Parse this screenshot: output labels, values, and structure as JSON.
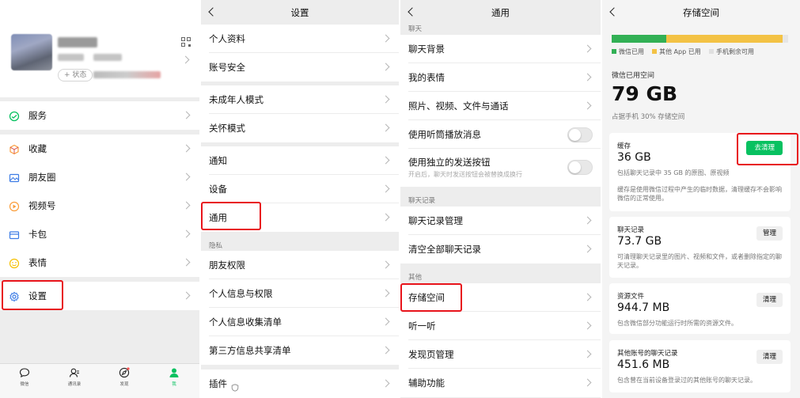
{
  "panel1": {
    "status_label": "+ 状态",
    "items": [
      {
        "label": "服务",
        "icon": "service-icon",
        "color": "#07c160"
      },
      {
        "label": "收藏",
        "icon": "favorites-icon",
        "color": "#fa9d3b"
      },
      {
        "label": "朋友圈",
        "icon": "moments-icon",
        "color": "#3d7ce5"
      },
      {
        "label": "视频号",
        "icon": "channels-icon",
        "color": "#fa9d3b"
      },
      {
        "label": "卡包",
        "icon": "card-icon",
        "color": "#3d7ce5"
      },
      {
        "label": "表情",
        "icon": "sticker-icon",
        "color": "#f5c000"
      },
      {
        "label": "设置",
        "icon": "settings-icon",
        "color": "#3d7ce5"
      }
    ],
    "tabs": [
      {
        "label": "微信",
        "icon": "chat-tab-icon"
      },
      {
        "label": "通讯录",
        "icon": "contacts-tab-icon"
      },
      {
        "label": "发现",
        "icon": "discover-tab-icon"
      },
      {
        "label": "我",
        "icon": "me-tab-icon",
        "active": true
      }
    ]
  },
  "panel2": {
    "title": "设置",
    "items": [
      "个人资料",
      "账号安全",
      "未成年人模式",
      "关怀模式",
      "通知",
      "设备",
      "通用"
    ],
    "section_privacy": "隐私",
    "privacy_items": [
      "朋友权限",
      "个人信息与权限",
      "个人信息收集清单",
      "第三方信息共享清单"
    ],
    "plugin": "插件"
  },
  "panel3": {
    "title": "通用",
    "section_chat": "聊天",
    "chat_items": [
      "聊天背景",
      "我的表情",
      "照片、视频、文件与通话"
    ],
    "toggle1": "使用听筒播放消息",
    "toggle2": "使用独立的发送按钮",
    "toggle2_desc": "开启后，聊天时发送按钮会被替换成换行",
    "section_history": "聊天记录",
    "history_items": [
      "聊天记录管理",
      "清空全部聊天记录"
    ],
    "section_other": "其他",
    "other_items": [
      "存储空间",
      "听一听",
      "发现页管理",
      "辅助功能"
    ]
  },
  "panel4": {
    "title": "存储空间",
    "usage": [
      {
        "label": "微信已用",
        "color": "#32b055",
        "fraction": 0.31
      },
      {
        "label": "其他 App 已用",
        "color": "#f3c245",
        "fraction": 0.66
      },
      {
        "label": "手机剩余可用",
        "color": "#e6e6e6",
        "fraction": 0.03
      }
    ],
    "wechat_used_label": "微信已用空间",
    "wechat_used_value": "79 GB",
    "wechat_used_sub": "占据手机 30% 存储空间",
    "cards": [
      {
        "title": "缓存",
        "value": "36 GB",
        "desc": "包括聊天记录中 35 GB 的原图、原视频",
        "desc2": "缓存是使用微信过程中产生的临时数据，清理缓存不会影响微信的正常使用。",
        "button": "去清理"
      },
      {
        "title": "聊天记录",
        "value": "73.7 GB",
        "desc": "可清理聊天记录里的图片、视频和文件，或者删除指定的聊天记录。",
        "button": "管理"
      },
      {
        "title": "资源文件",
        "value": "944.7 MB",
        "desc": "包含微信部分功能运行时所需的资源文件。",
        "button": "清理"
      },
      {
        "title": "其他账号的聊天记录",
        "value": "451.6 MB",
        "desc": "包含曾在当前设备登录过的其他账号的聊天记录。",
        "button": "清理"
      }
    ]
  }
}
